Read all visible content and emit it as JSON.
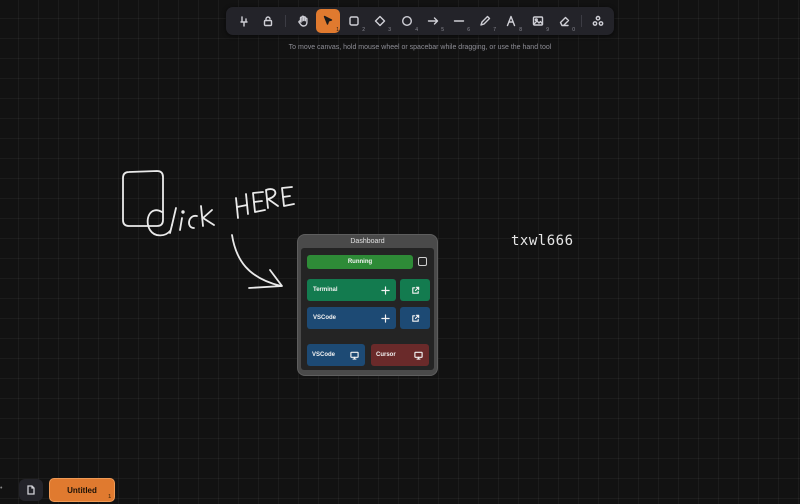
{
  "toolbar": {
    "tools": [
      {
        "name": "pin-tool",
        "icon": "pin-icon",
        "num": ""
      },
      {
        "name": "lock-tool",
        "icon": "lock-icon",
        "num": ""
      },
      {
        "name": "hand-tool",
        "icon": "hand-icon",
        "num": ""
      },
      {
        "name": "selection-tool",
        "icon": "pointer-icon",
        "num": "1",
        "active": true
      },
      {
        "name": "rectangle-tool",
        "icon": "square-icon",
        "num": "2"
      },
      {
        "name": "diamond-tool",
        "icon": "diamond-icon",
        "num": "3"
      },
      {
        "name": "ellipse-tool",
        "icon": "circle-icon",
        "num": "4"
      },
      {
        "name": "arrow-tool",
        "icon": "arrow-icon",
        "num": "5"
      },
      {
        "name": "line-tool",
        "icon": "line-icon",
        "num": "6"
      },
      {
        "name": "draw-tool",
        "icon": "pencil-icon",
        "num": "7"
      },
      {
        "name": "text-tool",
        "icon": "text-icon",
        "num": "8"
      },
      {
        "name": "image-tool",
        "icon": "image-icon",
        "num": "9"
      },
      {
        "name": "eraser-tool",
        "icon": "eraser-icon",
        "num": "0"
      },
      {
        "name": "more-tools",
        "icon": "shapes-icon",
        "num": ""
      }
    ],
    "accent": "#e07a2f"
  },
  "hint": "To move canvas, hold mouse wheel or spacebar while dragging, or use the hand tool",
  "canvas": {
    "sketch_text": "click HERE",
    "handle_text": "txwl666"
  },
  "card": {
    "title": "Dashboard",
    "running_label": "Running",
    "terminal_label": "Terminal",
    "vscode_label": "VSCode",
    "vscode_bottom_label": "VSCode",
    "cursor_label": "Cursor",
    "colors": {
      "running": "#2e8b37",
      "terminal": "#137b4f",
      "vscode": "#1d4a74",
      "cursor": "#6a2a2a"
    }
  },
  "footer": {
    "page_tab_label": "Untitled",
    "page_tab_sub": "1"
  }
}
